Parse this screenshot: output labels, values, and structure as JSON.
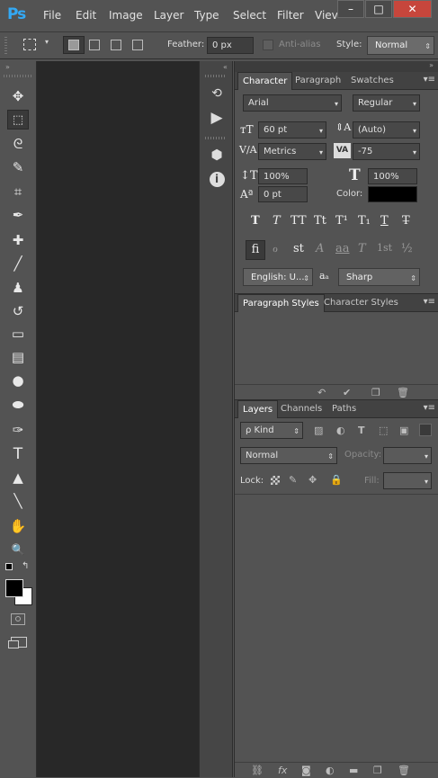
{
  "app": {
    "logo": "Ps",
    "accent": "#33a9f5"
  },
  "menu": [
    "File",
    "Edit",
    "Image",
    "Layer",
    "Type",
    "Select",
    "Filter",
    "Viev"
  ],
  "window_controls": [
    "–",
    "□",
    "✕"
  ],
  "options": {
    "feather_label": "Feather:",
    "feather_value": "0 px",
    "antialias_label": "Anti-alias",
    "style_label": "Style:",
    "style_value": "Normal"
  },
  "tools": [
    "move-tool",
    "marquee-tool",
    "lasso-tool",
    "quick-selection-tool",
    "crop-tool",
    "eyedropper-tool",
    "healing-brush-tool",
    "brush-tool",
    "clone-stamp-tool",
    "history-brush-tool",
    "eraser-tool",
    "gradient-tool",
    "blur-tool",
    "dodge-tool",
    "pen-tool",
    "type-tool",
    "path-selection-tool",
    "line-tool",
    "hand-tool",
    "zoom-tool"
  ],
  "tool_glyphs": [
    "✥",
    "⬚",
    "ᘓ",
    "✎",
    "⌗",
    "✒",
    "✚",
    "╱",
    "♟",
    "↺",
    "▭",
    "▤",
    "●",
    "⬬",
    "✑",
    "T",
    "▲",
    "╲",
    "✋",
    "🔍"
  ],
  "character": {
    "tabs": [
      "Character",
      "Paragraph",
      "Swatches"
    ],
    "font_family": "Arial",
    "font_style": "Regular",
    "size": "60 pt",
    "leading": "(Auto)",
    "kerning": "Metrics",
    "tracking": "-75",
    "vscale": "100%",
    "hscale": "100%",
    "baseline": "0 pt",
    "color_label": "Color:",
    "text_color": "#000000",
    "style_buttons": [
      "T",
      "T",
      "TT",
      "Tt",
      "T¹",
      "T₁",
      "T",
      "T̶"
    ],
    "ot_buttons": [
      "fi",
      "ℴ",
      "st",
      "A",
      "aa",
      "T",
      "1st",
      "½"
    ],
    "language": "English: U...",
    "aa_label": "aₐ",
    "antialias": "Sharp"
  },
  "styles_panel": {
    "tabs": [
      "Paragraph Styles",
      "Character Styles"
    ]
  },
  "layers": {
    "tabs": [
      "Layers",
      "Channels",
      "Paths"
    ],
    "kind_label": "ρ Kind",
    "blend_mode": "Normal",
    "opacity_label": "Opacity:",
    "lock_label": "Lock:",
    "fill_label": "Fill:"
  }
}
